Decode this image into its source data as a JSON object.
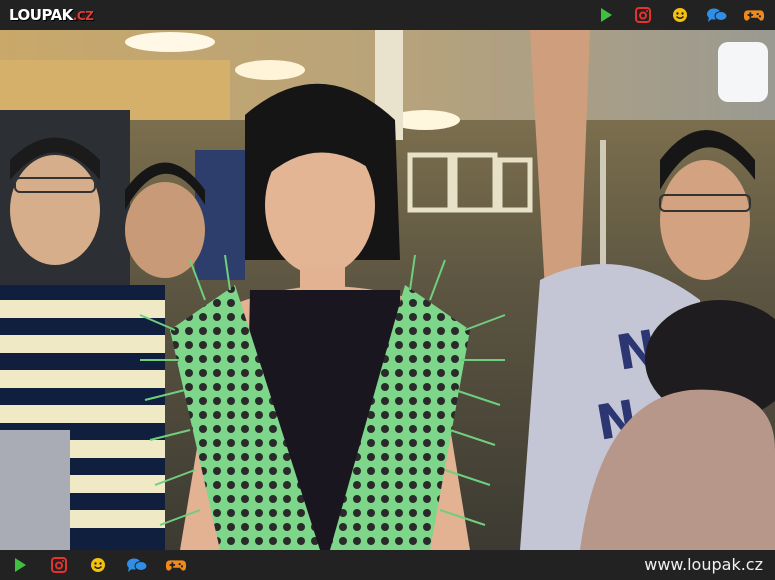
{
  "header": {
    "logo_main": "LOUPAK",
    "logo_tld": ".CZ"
  },
  "icons": {
    "play": "play-icon",
    "instagram": "instagram-icon",
    "smiley": "smiley-icon",
    "chat": "chat-bubbles-icon",
    "gamepad": "gamepad-icon"
  },
  "colors": {
    "bar_bg": "#222222",
    "logo_accent": "#e53935",
    "play": "#3fbf3f",
    "instagram": "#e5322d",
    "smiley": "#f4c20d",
    "chat": "#2f8ee5",
    "gamepad": "#f08a1c"
  },
  "footer": {
    "url": "www.loupak.cz"
  }
}
